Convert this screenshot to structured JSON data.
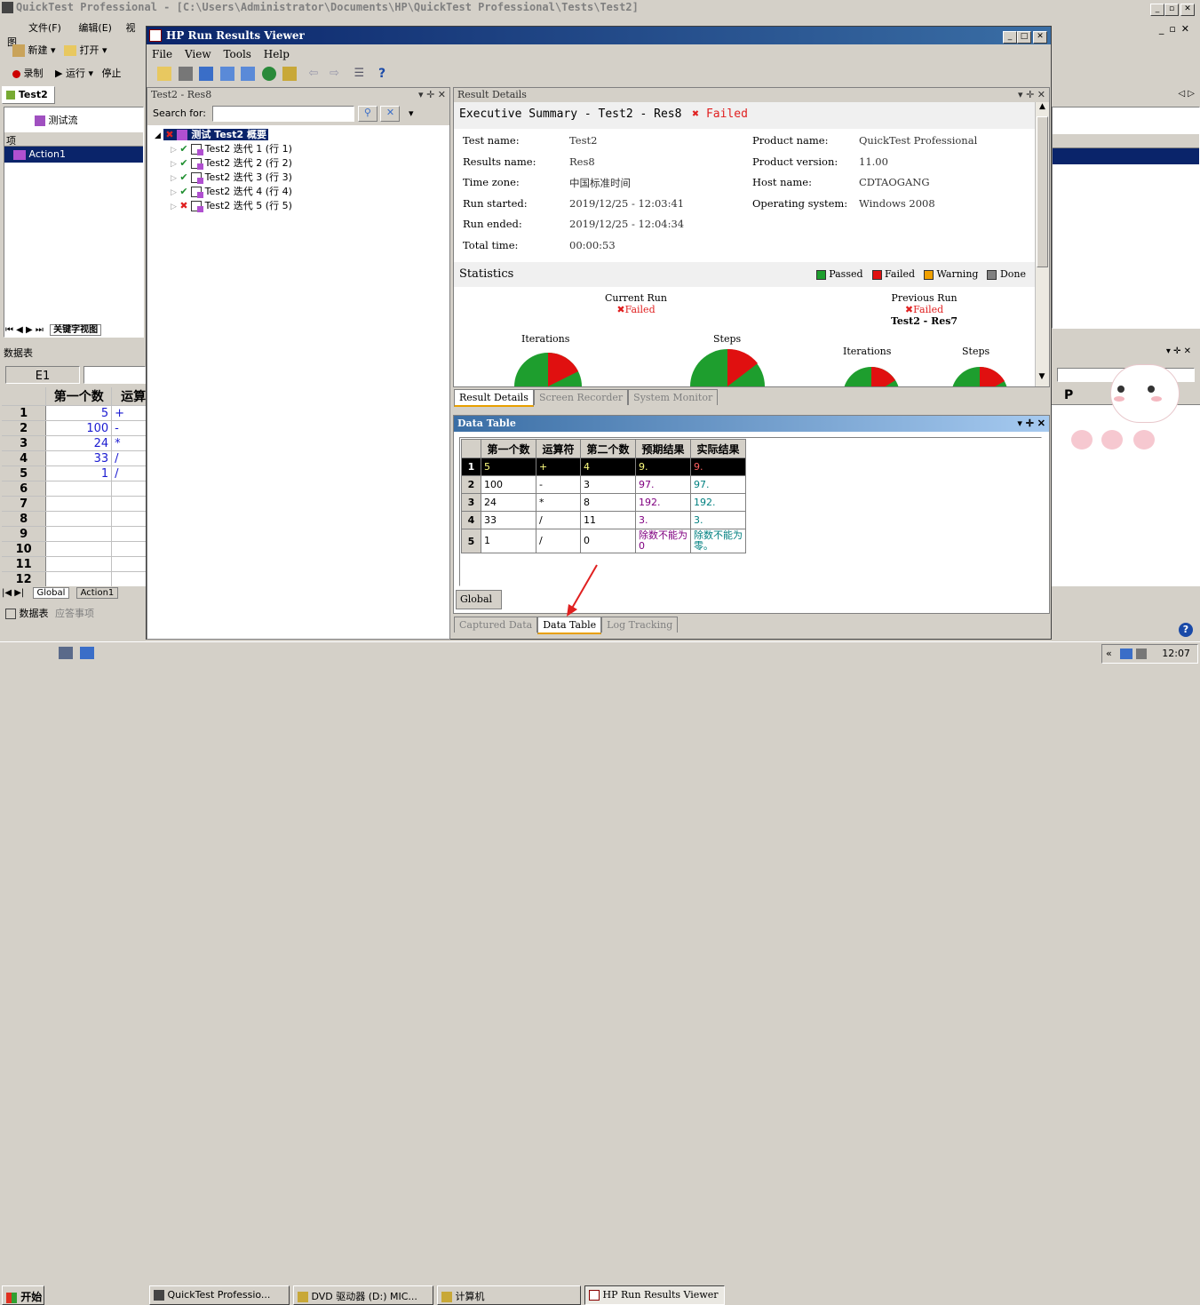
{
  "qtp": {
    "title": "QuickTest Professional - [C:\\Users\\Administrator\\Documents\\HP\\QuickTest Professional\\Tests\\Test2]",
    "menu": [
      "文件(F)",
      "编辑(E)",
      "视图"
    ],
    "toolbar1": [
      "新建",
      "打开"
    ],
    "toolbar2": [
      "录制",
      "运行",
      "停止"
    ],
    "test_tab": "Test2",
    "flow_label": "测试流",
    "tree_header": "项",
    "action1": "Action1",
    "keyword_view": "关键字视图",
    "datatable_title": "数据表",
    "cell_ref": "E1",
    "col_a": "第一个数",
    "col_b": "运算",
    "rows": [
      {
        "n": "1",
        "a": "5",
        "b": "+"
      },
      {
        "n": "2",
        "a": "100",
        "b": "-"
      },
      {
        "n": "3",
        "a": "24",
        "b": "*"
      },
      {
        "n": "4",
        "a": "33",
        "b": "/"
      },
      {
        "n": "5",
        "a": "1",
        "b": "/"
      },
      {
        "n": "6",
        "a": "",
        "b": ""
      },
      {
        "n": "7",
        "a": "",
        "b": ""
      },
      {
        "n": "8",
        "a": "",
        "b": ""
      },
      {
        "n": "9",
        "a": "",
        "b": ""
      },
      {
        "n": "10",
        "a": "",
        "b": ""
      },
      {
        "n": "11",
        "a": "",
        "b": ""
      },
      {
        "n": "12",
        "a": "",
        "b": ""
      }
    ],
    "sheet_tabs": [
      "Global",
      "Action1"
    ],
    "bottom_tabs": [
      "数据表",
      "应答事项"
    ],
    "right_col": "P"
  },
  "viewer": {
    "title": "HP Run Results Viewer",
    "menu": [
      "File",
      "View",
      "Tools",
      "Help"
    ],
    "left_pane_title": "Test2 - Res8",
    "search_label": "Search for:",
    "search_value": "",
    "tree_root": "测试 Test2 概要",
    "iterations": [
      {
        "label": "Test2 迭代 1 (行 1)",
        "status": "pass"
      },
      {
        "label": "Test2 迭代 2 (行 2)",
        "status": "pass"
      },
      {
        "label": "Test2 迭代 3 (行 3)",
        "status": "pass"
      },
      {
        "label": "Test2 迭代 4 (行 4)",
        "status": "pass"
      },
      {
        "label": "Test2 迭代 5 (行 5)",
        "status": "fail"
      }
    ],
    "details_pane_title": "Result Details",
    "exec_summary": "Executive Summary - Test2 - Res8",
    "exec_status": "Failed",
    "info_left": [
      {
        "k": "Test name:",
        "v": "Test2"
      },
      {
        "k": "Results name:",
        "v": "Res8"
      },
      {
        "k": "Time zone:",
        "v": "中国标准时间"
      },
      {
        "k": "Run started:",
        "v": "2019/12/25 - 12:03:41"
      },
      {
        "k": "Run ended:",
        "v": "2019/12/25 - 12:04:34"
      },
      {
        "k": "Total time:",
        "v": "00:00:53"
      }
    ],
    "info_right": [
      {
        "k": "Product name:",
        "v": "QuickTest Professional"
      },
      {
        "k": "Product version:",
        "v": "11.00"
      },
      {
        "k": "Host name:",
        "v": "CDTAOGANG"
      },
      {
        "k": "Operating system:",
        "v": "Windows 2008"
      }
    ],
    "statistics_title": "Statistics",
    "legend": [
      {
        "label": "Passed",
        "color": "#1e9e2e"
      },
      {
        "label": "Failed",
        "color": "#e01010"
      },
      {
        "label": "Warning",
        "color": "#f0a000"
      },
      {
        "label": "Done",
        "color": "#808080"
      }
    ],
    "current_run": "Current Run",
    "current_status": "Failed",
    "previous_run": "Previous Run",
    "previous_status": "Failed",
    "previous_name": "Test2 - Res7",
    "iter_label": "Iterations",
    "steps_label": "Steps",
    "detail_tabs": [
      "Result Details",
      "Screen Recorder",
      "System Monitor"
    ],
    "datatable_pane_title": "Data Table",
    "dt_headers": [
      "第一个数",
      "运算符",
      "第二个数",
      "预期结果",
      "实际结果"
    ],
    "dt_rows": [
      {
        "n": "1",
        "c": [
          "5",
          "+",
          "4",
          "9.",
          "9."
        ]
      },
      {
        "n": "2",
        "c": [
          "100",
          "-",
          "3",
          "97.",
          "97."
        ]
      },
      {
        "n": "3",
        "c": [
          "24",
          "*",
          "8",
          "192.",
          "192."
        ]
      },
      {
        "n": "4",
        "c": [
          "33",
          "/",
          "11",
          "3.",
          "3."
        ]
      },
      {
        "n": "5",
        "c": [
          "1",
          "/",
          "0",
          "除数不能为0",
          "除数不能为零。"
        ]
      }
    ],
    "dt_sheet_tab": "Global",
    "bottom_tabs": [
      "Captured Data",
      "Data Table",
      "Log Tracking"
    ]
  },
  "taskbar": {
    "start": "开始",
    "items": [
      "QuickTest Professio...",
      "DVD 驱动器 (D:) MIC...",
      "计算机",
      "HP Run Results Viewer"
    ],
    "clock": "12:07"
  },
  "colors": {
    "title_active": "#0a246a",
    "selection": "#0a246a",
    "annotation": "#e02020"
  }
}
